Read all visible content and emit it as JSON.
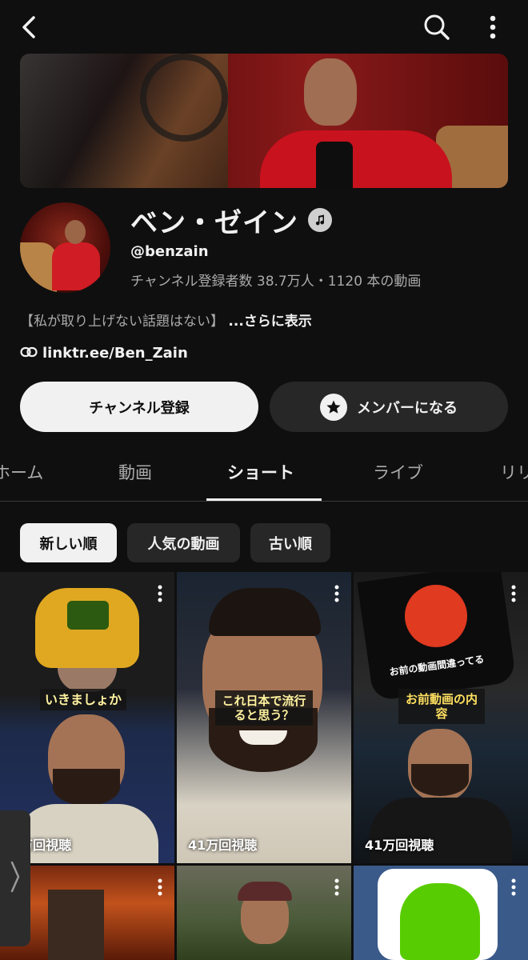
{
  "channel": {
    "name": "ベン・ゼイン",
    "handle": "@benzain",
    "stats": "チャンネル登録者数 38.7万人・1120 本の動画",
    "description": "【私が取り上げない話題はない】",
    "more_label": "...さらに表示",
    "link": "linktr.ee/Ben_Zain"
  },
  "buttons": {
    "subscribe": "チャンネル登録",
    "member": "メンバーになる"
  },
  "tabs": [
    {
      "label": "ホーム"
    },
    {
      "label": "動画"
    },
    {
      "label": "ショート",
      "active": true
    },
    {
      "label": "ライブ"
    },
    {
      "label": "リリ"
    }
  ],
  "chips": [
    {
      "label": "新しい順",
      "selected": true
    },
    {
      "label": "人気の動画"
    },
    {
      "label": "古い順"
    }
  ],
  "shorts": [
    {
      "caption": "いきましょか",
      "views": "7万回視聴"
    },
    {
      "caption": "これ日本で流行ると思う？",
      "views": "41万回視聴"
    },
    {
      "caption": "お前動画の内容",
      "overlay_text": "お前の動画間違ってる",
      "views": "41万回視聴"
    },
    {
      "views": ""
    },
    {
      "views": ""
    },
    {
      "views": ""
    }
  ],
  "icons": [
    "back-arrow-icon",
    "search-icon",
    "more-vert-icon",
    "verified-music-icon",
    "link-icon",
    "star-icon",
    "chevron-right-icon"
  ],
  "colors": {
    "background": "#0f0f0f",
    "primary_text": "#f1f1f1",
    "secondary_text": "#aaaaaa",
    "chip_bg": "#272727"
  }
}
